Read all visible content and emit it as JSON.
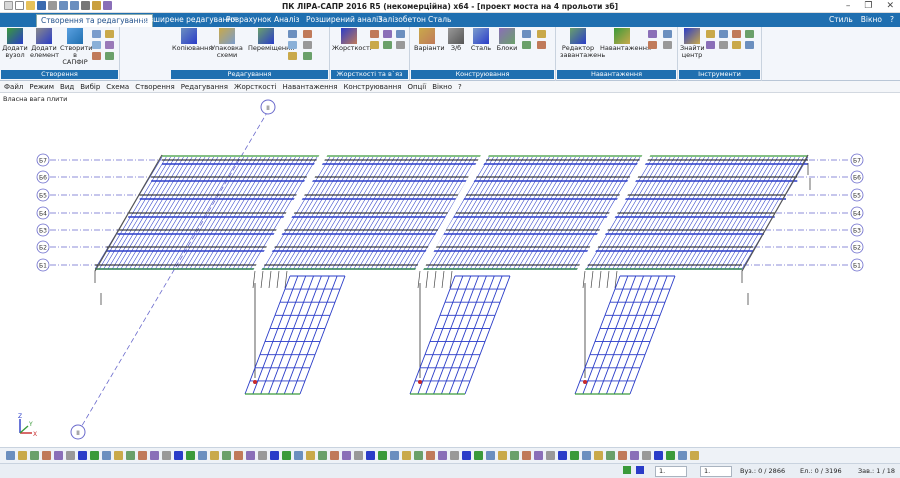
{
  "window": {
    "title": "ПК ЛІРА-САПР  2016 R5 (некомерційна) x64 - [проект моста на 4 прольоти зб]"
  },
  "tabs": [
    {
      "label": "Створення та редагування",
      "active": true
    },
    {
      "label": "Розширене редагування"
    },
    {
      "label": "Розрахунок"
    },
    {
      "label": "Аналіз"
    },
    {
      "label": "Розширений аналіз"
    },
    {
      "label": "Залізобетон"
    },
    {
      "label": "Сталь"
    }
  ],
  "tabs_right": {
    "style": "Стиль",
    "window": "Вікно"
  },
  "ribbon": {
    "groups": [
      {
        "label": "Створення",
        "buttons": [
          "Додати вузол",
          "Додати елемент",
          "Створити в САПФІР"
        ]
      },
      {
        "label": "Редагування",
        "buttons": [
          "Копіювання",
          "Упаковка схеми",
          "Переміщення"
        ]
      },
      {
        "label": "Жорсткості та в`яз",
        "buttons": [
          "Жорсткості"
        ]
      },
      {
        "label": "Конструювання",
        "buttons": [
          "Варіанти",
          "З/б",
          "Сталь",
          "Блоки"
        ]
      },
      {
        "label": "Навантаження",
        "buttons": [
          "Редактор завантажень",
          "Навантаження"
        ]
      },
      {
        "label": "Інструменти",
        "buttons": [
          "Знайти центр"
        ]
      }
    ]
  },
  "menu": [
    "Файл",
    "Режим",
    "Вид",
    "Вибір",
    "Схема",
    "Створення",
    "Редагування",
    "Жорсткості",
    "Навантаження",
    "Конструювання",
    "Опції",
    "Вікно",
    "?"
  ],
  "viewport": {
    "label": "Власна вага плити",
    "section_marker": "II",
    "axis_labels": [
      "Б7",
      "Б6",
      "Б5",
      "Б4",
      "Б3",
      "Б2",
      "Б1"
    ],
    "axis_icon": {
      "z": "Z",
      "y": "Y",
      "x": "X"
    }
  },
  "status": {
    "field1": "1.",
    "field2": "1.",
    "nodes": "Вуз.: 0 / 2866",
    "elements": "Ел.: 0 / 3196",
    "loadcase": "Зав.: 1 / 18"
  },
  "colors": {
    "accent": "#1f6fb0",
    "beam_blue": "#2a3cc8",
    "beam_green": "#3a9a3a",
    "axis_line": "#6a6acc"
  }
}
